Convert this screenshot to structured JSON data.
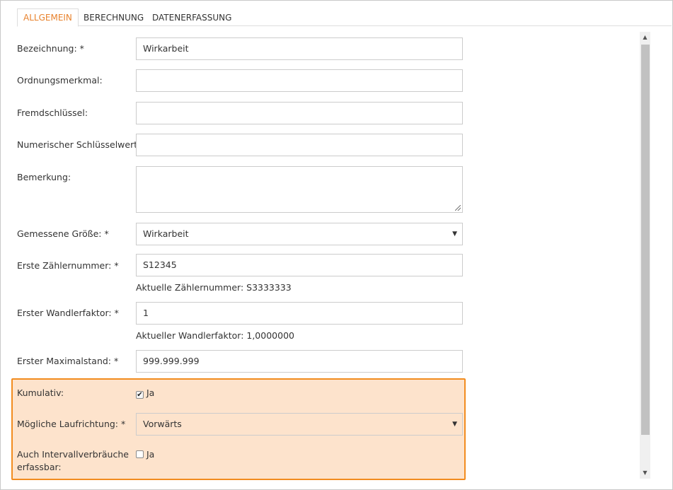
{
  "tabs": [
    {
      "label": "ALLGEMEIN",
      "active": true
    },
    {
      "label": "BERECHNUNG",
      "active": false
    },
    {
      "label": "DATENERFASSUNG",
      "active": false
    }
  ],
  "form": {
    "bezeichnung": {
      "label": "Bezeichnung: *",
      "value": "Wirkarbeit"
    },
    "ordnungsmerkmal": {
      "label": "Ordnungsmerkmal:",
      "value": ""
    },
    "fremdschluessel": {
      "label": "Fremdschlüssel:",
      "value": ""
    },
    "numerischer_schluesselwert": {
      "label": "Numerischer Schlüsselwert:",
      "value": ""
    },
    "bemerkung": {
      "label": "Bemerkung:",
      "value": ""
    },
    "gemessene_groesse": {
      "label": "Gemessene Größe: *",
      "value": "Wirkarbeit"
    },
    "erste_zaehlernummer": {
      "label": "Erste Zählernummer: *",
      "value": "S12345",
      "hint": "Aktuelle Zählernummer: S3333333"
    },
    "erster_wandlerfaktor": {
      "label": "Erster Wandlerfaktor: *",
      "value": "1",
      "hint": "Aktueller Wandlerfaktor: 1,0000000"
    },
    "erster_maximalstand": {
      "label": "Erster Maximalstand: *",
      "value": "999.999.999"
    },
    "kumulativ": {
      "label": "Kumulativ:",
      "checked": true,
      "option_label": "Ja"
    },
    "moegliche_laufrichtung": {
      "label": "Mögliche Laufrichtung: *",
      "value": "Vorwärts"
    },
    "intervallverbraeuche": {
      "label_line1": "Auch Intervallverbräuche",
      "label_line2": "erfassbar:",
      "checked": false,
      "option_label": "Ja"
    }
  },
  "icons": {
    "select_caret": "▼",
    "scroll_up": "▲",
    "scroll_down": "▼",
    "check": "✔"
  },
  "colors": {
    "accent": "#e8822d",
    "highlight_border": "#f28c1f",
    "highlight_fill": "#fde3cc"
  }
}
